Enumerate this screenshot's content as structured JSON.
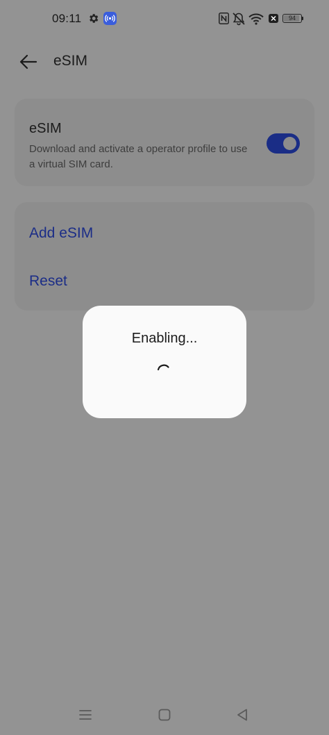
{
  "status_bar": {
    "time": "09:11",
    "battery": "94",
    "battery_fraction": 0.94,
    "icons": [
      "gear-icon",
      "hotspot-icon",
      "nfc-icon",
      "mute-icon",
      "wifi-icon",
      "sim-x-icon",
      "battery-icon"
    ]
  },
  "app_bar": {
    "title": "eSIM",
    "back_icon": "arrow-left-icon"
  },
  "esim_card": {
    "title": "eSIM",
    "description": "Download and activate a operator profile to use a virtual SIM card.",
    "toggle_on": true
  },
  "actions": {
    "add": "Add eSIM",
    "reset": "Reset"
  },
  "dialog": {
    "text": "Enabling..."
  },
  "nav_bar": {
    "icons": [
      "menu-icon",
      "home-square-icon",
      "back-triangle-icon"
    ]
  },
  "colors": {
    "accent": "#1b2d87",
    "toggle_track": "#1a2d86",
    "scrim": "#939393",
    "dialog_bg": "#fafafa"
  }
}
